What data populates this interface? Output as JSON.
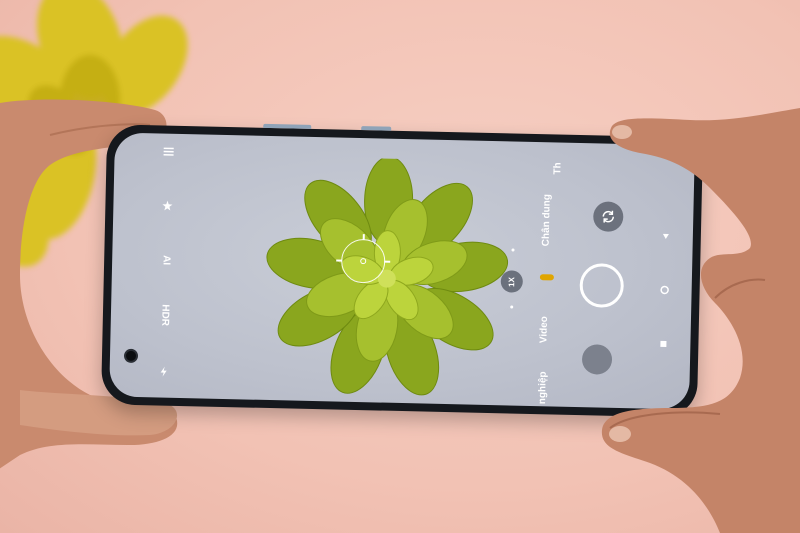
{
  "camera": {
    "toolbar": {
      "ai_label": "AI",
      "hdr_label": "HDR"
    },
    "modes": {
      "portrait": "Chân dung",
      "video": "Video",
      "pro": "nghiệp",
      "more": "Th"
    },
    "zoom_label": "1X"
  },
  "colors": {
    "background": "#f2c2b4",
    "phone_body": "#15181d",
    "screen_bg": "#c9cdd7",
    "plant_green": "#9fb62c",
    "accent_mode": "#e0a500"
  }
}
